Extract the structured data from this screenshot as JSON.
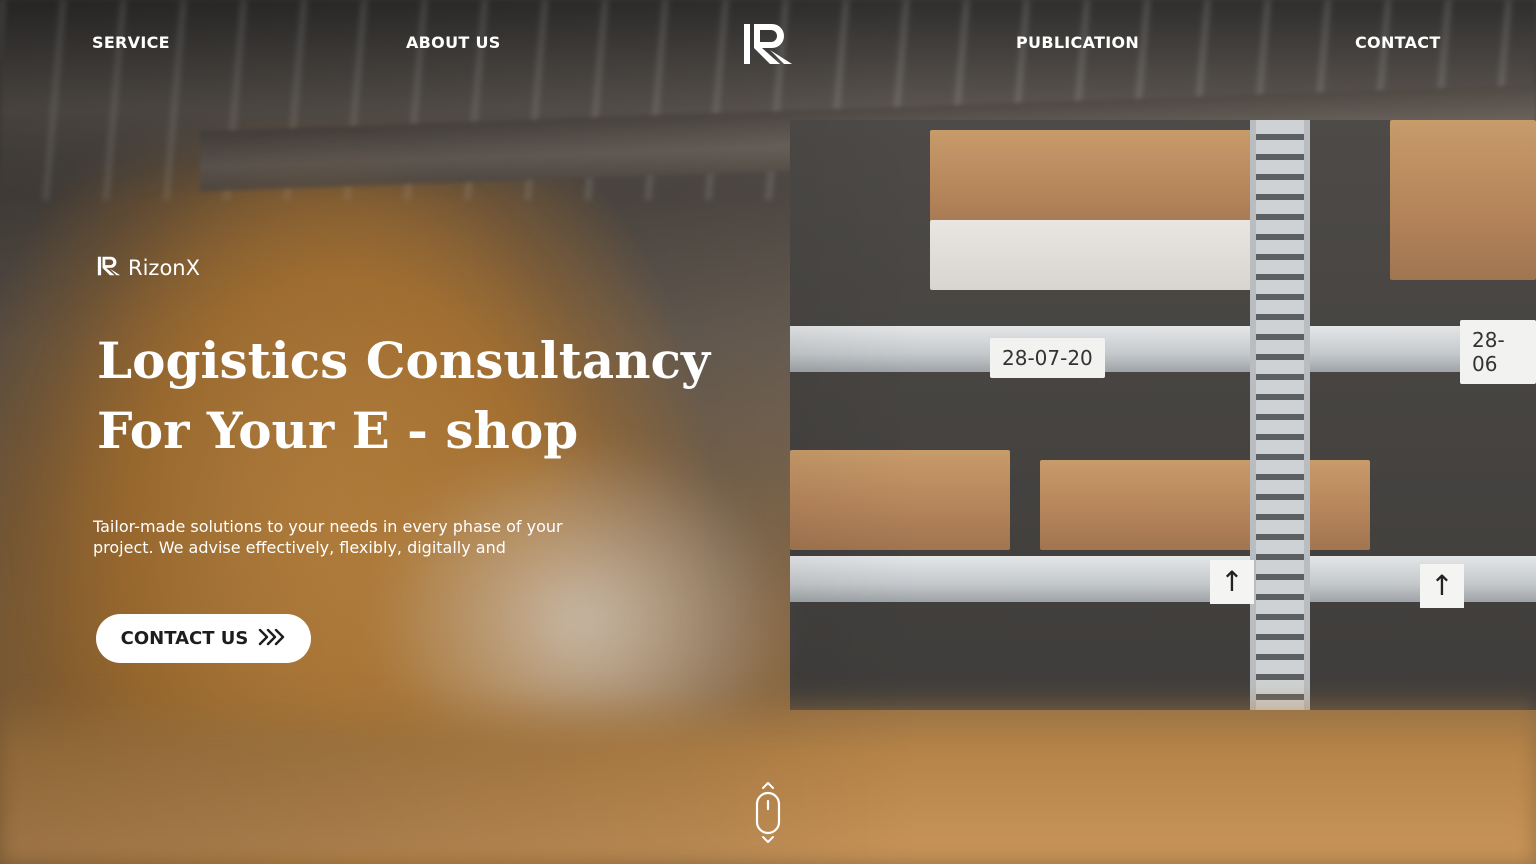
{
  "nav": {
    "items": [
      {
        "label": "SERVICE"
      },
      {
        "label": "ABOUT US"
      },
      {
        "label": "PUBLICATION"
      },
      {
        "label": "CONTACT"
      }
    ],
    "logo_icon": "rizonx-logo-icon"
  },
  "brand": {
    "name": "RizonX",
    "icon": "rizonx-logo-icon"
  },
  "hero": {
    "title_line1": "Logistics Consultancy",
    "title_line2": "For Your E - shop",
    "description": "Tailor-made solutions to your needs in every phase of your project. We advise effectively, flexibly, digitally and",
    "cta_label": "CONTACT US",
    "cta_icon": "triple-chevron-right-icon"
  },
  "background": {
    "shelf_labels": [
      "28-07-20",
      "28-06"
    ]
  },
  "scroll_indicator": {
    "icon": "mouse-scroll-icon"
  },
  "colors": {
    "text": "#ffffff",
    "button_bg": "#ffffff",
    "button_text": "#1d1d1d"
  }
}
